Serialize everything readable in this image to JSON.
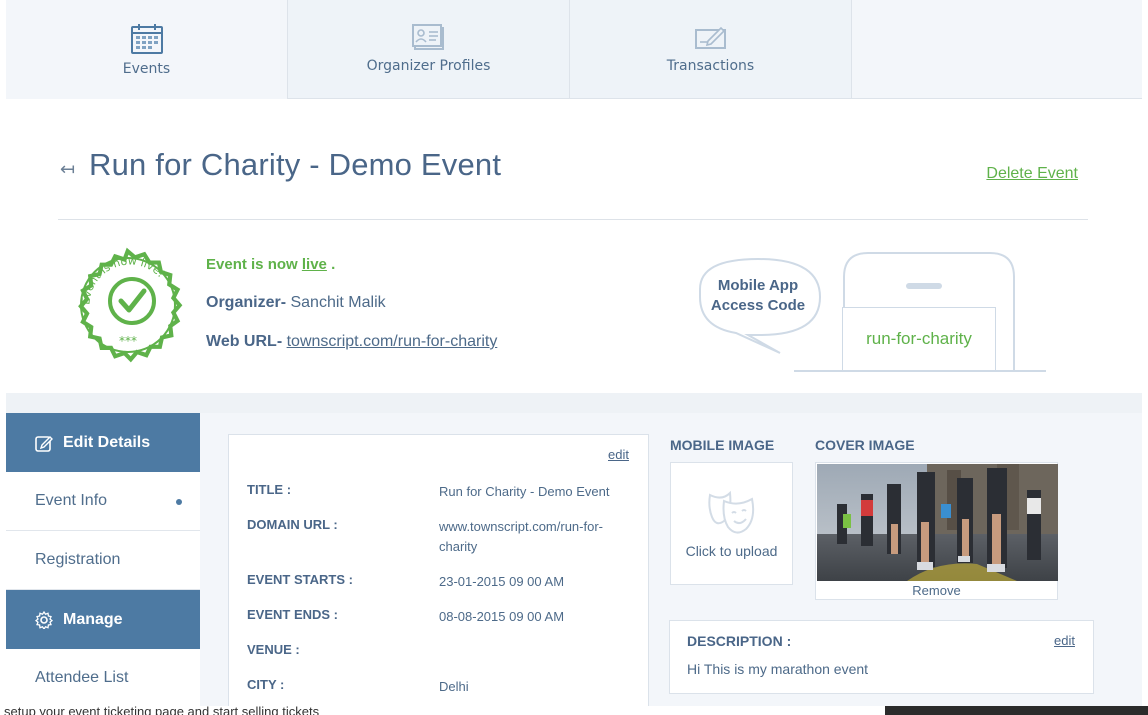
{
  "tabs": [
    {
      "label": "Events",
      "icon": "calendar-icon"
    },
    {
      "label": "Organizer Profiles",
      "icon": "id-card-icon"
    },
    {
      "label": "Transactions",
      "icon": "cheque-icon"
    }
  ],
  "header": {
    "title": "Run for Charity - Demo Event",
    "delete_label": "Delete Event"
  },
  "status": {
    "prefix": "Event is now",
    "link": "live",
    "suffix": ".",
    "badge_text": "Event is now live!",
    "badge_stars": "***"
  },
  "organizer": {
    "label": "Organizer-",
    "value": "Sanchit Malik"
  },
  "web_url": {
    "label": "Web URL-",
    "value": "townscript.com/run-for-charity"
  },
  "mobile_app": {
    "bubble": "Mobile App Access Code",
    "code": "run-for-charity"
  },
  "sidebar": {
    "items": [
      {
        "label": "Edit Details",
        "type": "head",
        "icon": "edit-icon"
      },
      {
        "label": "Event Info",
        "type": "item"
      },
      {
        "label": "Registration",
        "type": "item"
      },
      {
        "label": "Manage",
        "type": "head",
        "icon": "gear-icon"
      },
      {
        "label": "Attendee List",
        "type": "item"
      }
    ]
  },
  "details": {
    "edit_label": "edit",
    "rows": [
      {
        "key": "TITLE :",
        "value": "Run for Charity - Demo Event"
      },
      {
        "key": "DOMAIN URL :",
        "value": "www.townscript.com/run-for-charity"
      },
      {
        "key": "EVENT STARTS :",
        "value": "23-01-2015 09 00 AM"
      },
      {
        "key": "EVENT ENDS :",
        "value": "08-08-2015 09 00 AM"
      },
      {
        "key": "VENUE :",
        "value": ""
      },
      {
        "key": "CITY :",
        "value": "Delhi"
      }
    ]
  },
  "images": {
    "mobile_label": "MOBILE IMAGE",
    "upload_text": "Click to upload",
    "cover_label": "COVER IMAGE",
    "remove_text": "Remove"
  },
  "description": {
    "label": "DESCRIPTION :",
    "edit_label": "edit",
    "text": "Hi This is my marathon event"
  },
  "footer_text": "setup your event ticketing page and start selling tickets",
  "colors": {
    "accent": "#4d7aa3",
    "live": "#5fb24a",
    "title": "#4a6688"
  }
}
